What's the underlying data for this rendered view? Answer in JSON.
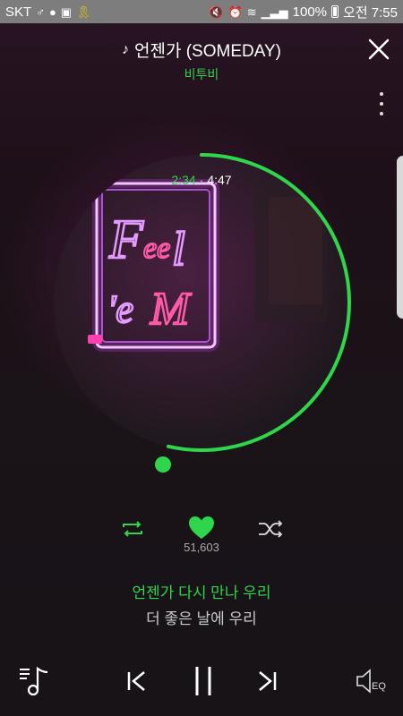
{
  "status_bar": {
    "carrier": "SKT",
    "battery": "100%",
    "time": "오전 7:55"
  },
  "header": {
    "song_title": "언젠가 (SOMEDAY)",
    "artist": "비투비",
    "title_icon": "music-note-icon",
    "close_icon": "close-icon",
    "more_icon": "more-vertical-icon"
  },
  "playback": {
    "elapsed": "2:34",
    "total": "4:47",
    "progress_fraction": 0.536
  },
  "album_art": {
    "description_icon": "neon-sign-album-art"
  },
  "actions": {
    "repeat_icon": "repeat-icon",
    "like_icon": "heart-icon",
    "like_count": "51,603",
    "shuffle_icon": "shuffle-icon"
  },
  "lyrics": {
    "current": "언젠가 다시 만나 우리",
    "next": "더 좋은 날에 우리"
  },
  "controls": {
    "playlist_icon": "playlist-icon",
    "prev_icon": "skip-previous-icon",
    "pause_icon": "pause-icon",
    "next_icon": "skip-next-icon",
    "eq_icon": "equalizer-speaker-icon",
    "eq_label": "EQ"
  },
  "colors": {
    "accent": "#2fd54a",
    "background": "#1a1117",
    "status_bar": "#7d7d7d"
  }
}
